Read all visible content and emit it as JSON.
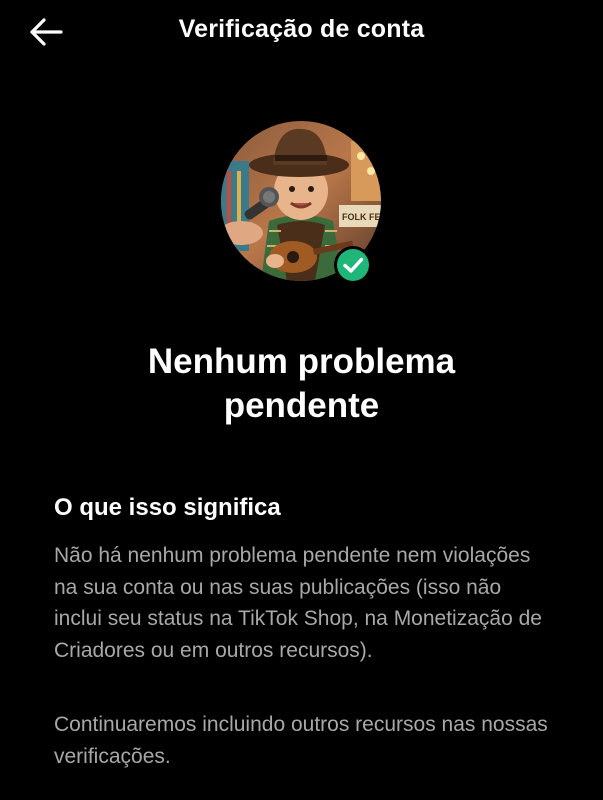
{
  "header": {
    "title": "Verificação de conta",
    "back_icon": "arrow-left-icon"
  },
  "avatar": {
    "icon": "profile-photo",
    "badge_icon": "check-circle-icon",
    "badge_color": "#1fb67a",
    "image_text": "FOLK FES"
  },
  "main": {
    "heading_line1": "Nenhum problema",
    "heading_line2": "pendente",
    "section_title": "O que isso significa",
    "paragraph_1": "Não há nenhum problema pendente nem violações na sua conta ou nas suas publicações (isso não inclui seu status na TikTok Shop, na Monetização de Criadores ou em outros recursos).",
    "paragraph_2": "Continuaremos incluindo outros recursos nas nossas verificações."
  },
  "colors": {
    "background": "#000000",
    "text_primary": "#ffffff",
    "text_secondary": "#a8a8a8"
  }
}
